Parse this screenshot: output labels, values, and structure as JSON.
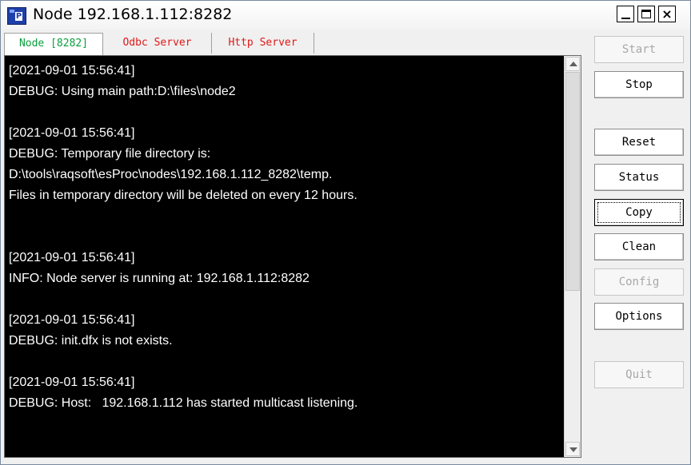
{
  "window": {
    "title": "Node 192.168.1.112:8282",
    "minimize_label": "_",
    "close_label": "×"
  },
  "tabs": [
    {
      "label": "Node [8282]",
      "active": true,
      "color": "#0aa03c"
    },
    {
      "label": "Odbc Server",
      "active": false,
      "color": "#e01818"
    },
    {
      "label": "Http Server",
      "active": false,
      "color": "#e01818"
    }
  ],
  "console": {
    "lines": [
      "[2021-09-01 15:56:41]",
      "DEBUG: Using main path:D:\\files\\node2",
      "",
      "[2021-09-01 15:56:41]",
      "DEBUG: Temporary file directory is:",
      "D:\\tools\\raqsoft\\esProc\\nodes\\192.168.1.112_8282\\temp.",
      "Files in temporary directory will be deleted on every 12 hours.",
      "",
      "",
      "[2021-09-01 15:56:41]",
      "INFO: Node server is running at: 192.168.1.112:8282",
      "",
      "[2021-09-01 15:56:41]",
      "DEBUG: init.dfx is not exists.",
      "",
      "[2021-09-01 15:56:41]",
      "DEBUG: Host:   192.168.1.112 has started multicast listening."
    ]
  },
  "buttons": {
    "start": "Start",
    "stop": "Stop",
    "reset": "Reset",
    "status": "Status",
    "copy": "Copy",
    "clean": "Clean",
    "config": "Config",
    "options": "Options",
    "quit": "Quit"
  }
}
